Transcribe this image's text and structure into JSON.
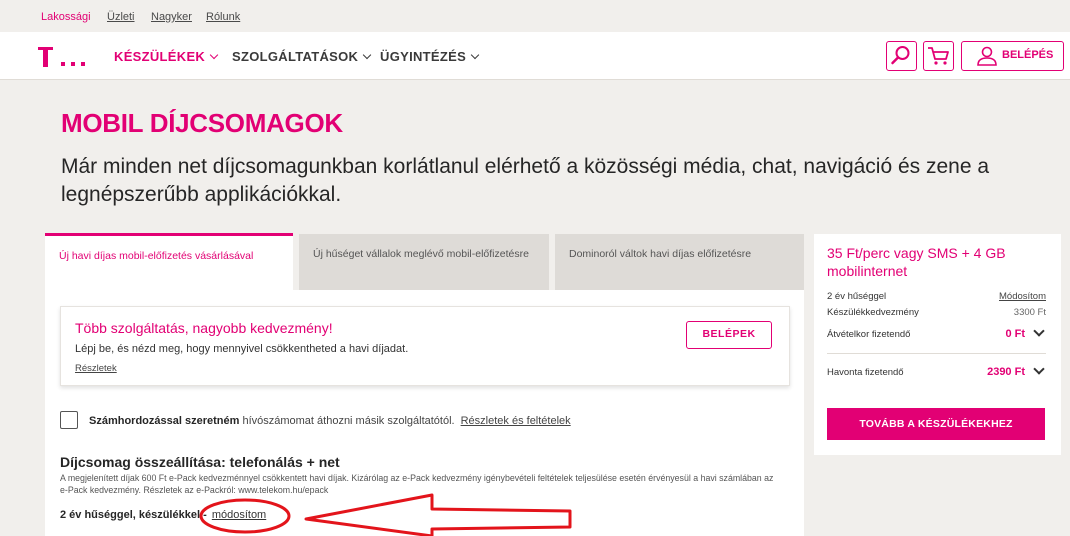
{
  "utilbar": {
    "items": [
      "Lakossági",
      "Üzleti",
      "Nagyker",
      "Rólunk"
    ]
  },
  "header": {
    "nav": [
      {
        "label": "KÉSZÜLÉKEK"
      },
      {
        "label": "SZOLGÁLTATÁSOK"
      },
      {
        "label": "ÜGYINTÉZÉS"
      }
    ],
    "login_label": "BELÉPÉS",
    "icons": [
      "search-icon",
      "cart-icon",
      "user-icon"
    ]
  },
  "hero": {
    "title": "MOBIL DÍJCSOMAGOK",
    "subtitle": "Már minden net díjcsomagunkban korlátlanul elérhető a közösségi média, chat, navigáció és zene a legnépszerűbb applikációkkal."
  },
  "tabs": [
    {
      "label": "Új havi díjas mobil-előfizetés vásárlásával"
    },
    {
      "label": "Új hűséget vállalok meglévő mobil-előfizetésre"
    },
    {
      "label": "Dominoról váltok havi díjas előfizetésre"
    }
  ],
  "promo": {
    "title": "Több szolgáltatás, nagyobb kedvezmény!",
    "text": "Lépj be, és nézd meg, hogy mennyivel csökkentheted a havi díjadat.",
    "link": "Részletek",
    "button": "BELÉPEK"
  },
  "porting": {
    "bold": "Számhordozással szeretném",
    "text": " hívószámomat áthozni másik szolgáltatótól.",
    "link": "Részletek és feltételek"
  },
  "package": {
    "title": "Díjcsomag összeállítása: telefonálás + net",
    "desc": "A megjelenített díjak 600 Ft e-Pack kedvezménnyel csökkentett havi díjak. Kizárólag az e-Pack kedvezmény igénybevételi feltételek teljesülése esetén érvényesül a havi számlában az e-Pack kedvezmény. Részletek az e-Packról: www.telekom.hu/epack",
    "years": "2 év hűséggel, készülékkel -",
    "modify": "módosítom"
  },
  "summary": {
    "title": "35 Ft/perc vagy SMS + 4 GB mobilinternet",
    "loyalty": "2 év hűséggel",
    "loyalty_link": "Módosítom",
    "device_discount_label": "Készülékkedvezmény",
    "device_discount_value": "3300 Ft",
    "pickup_label": "Átvételkor fizetendő",
    "pickup_value": "0 Ft",
    "monthly_label": "Havonta fizetendő",
    "monthly_value": "2390 Ft",
    "cta": "TOVÁBB A KÉSZÜLÉKEKHEZ"
  },
  "colors": {
    "brand": "#e20074",
    "annotation": "#e3141b"
  }
}
